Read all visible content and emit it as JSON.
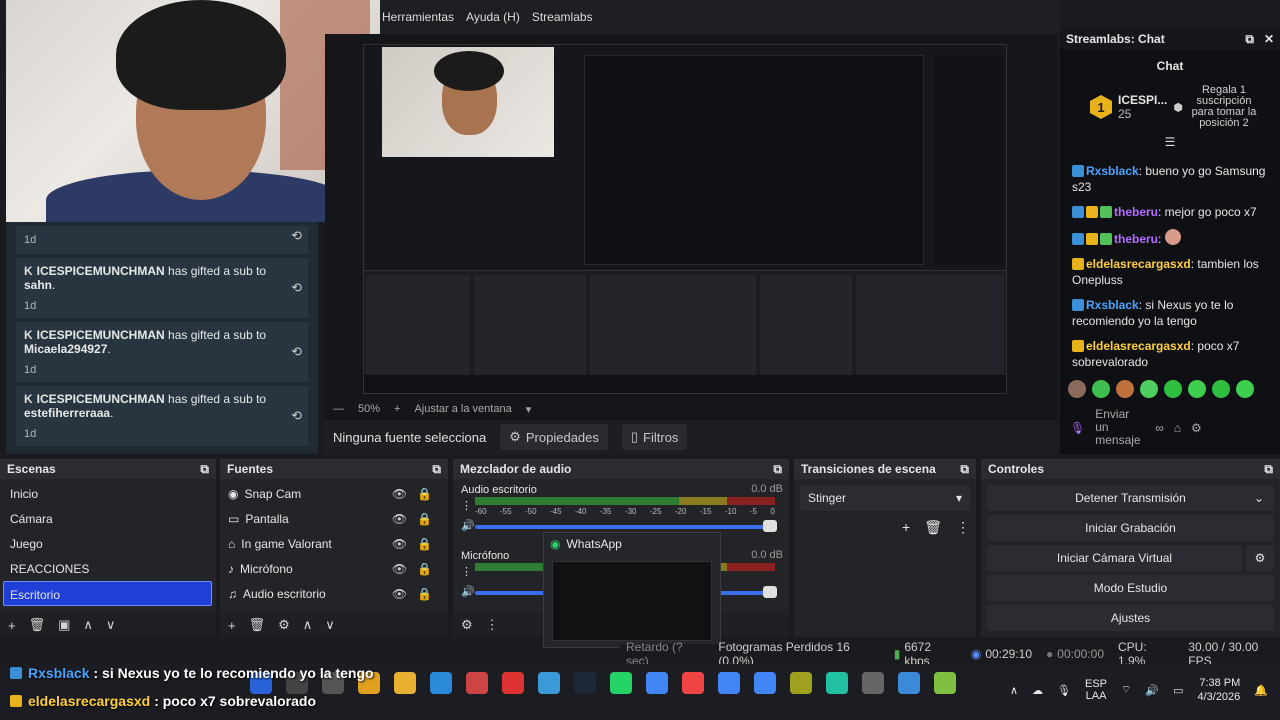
{
  "menu": [
    "Herramientas",
    "Ayuda (H)",
    "Streamlabs"
  ],
  "left_chat": {
    "items": [
      {
        "time": "1d"
      },
      {
        "gifter": "ICESPICEMUNCHMAN",
        "text": " has gifted a sub to ",
        "to": "sahn",
        "time": "1d"
      },
      {
        "gifter": "ICESPICEMUNCHMAN",
        "text": " has gifted a sub to ",
        "to": "Micaela294927",
        "time": "1d"
      },
      {
        "gifter": "ICESPICEMUNCHMAN",
        "text": " has gifted a sub to ",
        "to": "estefiherreraaa",
        "time": "1d"
      }
    ]
  },
  "preview": {
    "zoom": "50%",
    "fit": "Ajustar a la ventana",
    "no_source": "Ninguna fuente selecciona",
    "properties": "Propiedades",
    "filters": "Filtros"
  },
  "streamlabs_chat": {
    "window_title": "Streamlabs: Chat",
    "title": "Chat",
    "goal_rank": "1",
    "goal_name": "ICESPI...",
    "goal_count": "25",
    "goal_text": "Regala 1 suscripción para tomar la posición 2",
    "messages": [
      {
        "user": "Rxsblack",
        "cls": "u1",
        "text": ": bueno yo go Samsung s23"
      },
      {
        "user": "theberu",
        "cls": "u2",
        "text": ": mejor go poco x7"
      },
      {
        "user": "theberu",
        "cls": "u2",
        "text": ":"
      },
      {
        "user": "eldelasrecargasxd",
        "cls": "u3",
        "text": ": tambien los Onepluss"
      },
      {
        "user": "Rxsblack",
        "cls": "u1",
        "text": ": si Nexus yo te lo recomiendo yo la tengo"
      },
      {
        "user": "eldelasrecargasxd",
        "cls": "u3",
        "text": ": poco x7 sobrevalorado"
      }
    ],
    "send_placeholder": "Enviar un mensaje"
  },
  "scenes": {
    "title": "Escenas",
    "items": [
      "Inicio",
      "Cámara",
      "Juego",
      "REACCIONES",
      "Escritorio"
    ],
    "active": "Escritorio"
  },
  "sources": {
    "title": "Fuentes",
    "items": [
      "Snap Cam",
      "Pantalla",
      "In game Valorant",
      "Micrófono",
      "Audio escritorio"
    ]
  },
  "mixer": {
    "title": "Mezclador de audio",
    "channels": [
      {
        "name": "Audio escritorio",
        "db": "0.0 dB"
      },
      {
        "name": "Micrófono",
        "db": "0.0 dB"
      }
    ],
    "ticks": [
      "-60",
      "-55",
      "-50",
      "-45",
      "-40",
      "-35",
      "-30",
      "-25",
      "-20",
      "-15",
      "-10",
      "-5",
      "0"
    ]
  },
  "transitions": {
    "title": "Transiciones de escena",
    "selected": "Stinger"
  },
  "controls": {
    "title": "Controles",
    "buttons": [
      "Detener Transmisión",
      "Iniciar Grabación",
      "Iniciar Cámara Virtual",
      "Modo Estudio",
      "Ajustes"
    ]
  },
  "whatsapp": {
    "title": "WhatsApp"
  },
  "statusbar": {
    "delay": "Retardo (? sec)",
    "dropped": "Fotogramas Perdidos 16 (0.0%)",
    "kbps": "6672 kbps",
    "live_time": "00:29:10",
    "rec_time": "00:00:00",
    "cpu": "CPU: 1.9%",
    "fps": "30.00 / 30.00 FPS"
  },
  "alerts": [
    {
      "user": "Rxsblack",
      "text": " : si Nexus yo te lo recomiendo yo la tengo"
    },
    {
      "user": "eldelasrecargasxd",
      "text": " : poco x7 sobrevalorado"
    }
  ],
  "taskbar": {
    "lang": "ESP",
    "lang2": "LAA",
    "time": "7:38 PM",
    "date": "4/3/2026"
  },
  "colors": {
    "accent": "#1f3fd6",
    "mod_badge": "#3b8fd6",
    "vip_badge": "#e8b21b",
    "whatsapp": "#25d366"
  }
}
